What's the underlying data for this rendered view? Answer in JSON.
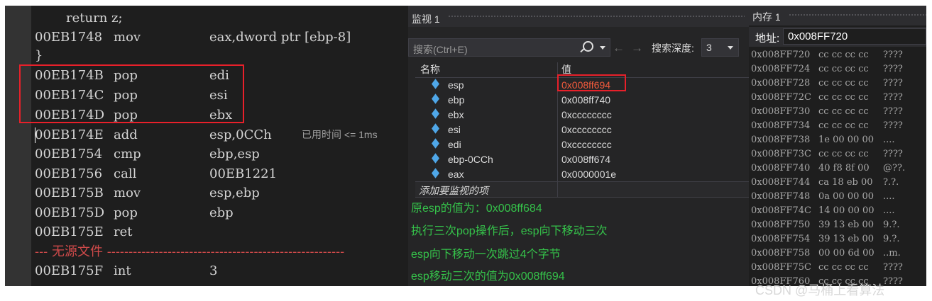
{
  "disasm": {
    "source_return": "return z;",
    "brace": "}",
    "lines": [
      {
        "addr": "00EB1748",
        "op": "mov",
        "arg": "eax,dword ptr [ebp-8]"
      },
      {
        "addr": "00EB174B",
        "op": "pop",
        "arg": "edi"
      },
      {
        "addr": "00EB174C",
        "op": "pop",
        "arg": "esi"
      },
      {
        "addr": "00EB174D",
        "op": "pop",
        "arg": "ebx"
      },
      {
        "addr": "00EB174E",
        "op": "add",
        "arg": "esp,0CCh"
      },
      {
        "addr": "00EB1754",
        "op": "cmp",
        "arg": "ebp,esp"
      },
      {
        "addr": "00EB1756",
        "op": "call",
        "arg": "00EB1221"
      },
      {
        "addr": "00EB175B",
        "op": "mov",
        "arg": "esp,ebp"
      },
      {
        "addr": "00EB175D",
        "op": "pop",
        "arg": "ebp"
      },
      {
        "addr": "00EB175E",
        "op": "ret",
        "arg": ""
      },
      {
        "addr": "00EB175F",
        "op": "int",
        "arg": "3"
      }
    ],
    "no_source_label": "--- 无源文件 -------------------------------------------------------",
    "elapsed": "已用时间 <= 1ms",
    "current_icon": "current-instruction-arrow-icon"
  },
  "watch": {
    "title": "监视 1",
    "search_placeholder": "搜索(Ctrl+E)",
    "search_icon": "search-icon",
    "depth_label": "搜索深度:",
    "depth_value": "3",
    "col_name": "名称",
    "col_value": "值",
    "rows": [
      {
        "name": "esp",
        "value": "0x008ff694",
        "changed": true
      },
      {
        "name": "ebp",
        "value": "0x008ff740",
        "changed": false
      },
      {
        "name": "ebx",
        "value": "0xcccccccc",
        "changed": false
      },
      {
        "name": "esi",
        "value": "0xcccccccc",
        "changed": false
      },
      {
        "name": "edi",
        "value": "0xcccccccc",
        "changed": false
      },
      {
        "name": "ebp-0CCh",
        "value": "0x008ff674",
        "changed": false
      },
      {
        "name": "eax",
        "value": "0x0000001e",
        "changed": false
      }
    ],
    "add_item": "添加要监视的项",
    "notes": [
      "原esp的值为：0x008ff684",
      "执行三次pop操作后，esp向下移动三次",
      "esp向下移动一次跳过4个字节",
      "esp移动三次的值为0x008ff694"
    ]
  },
  "memory": {
    "title": "内存 1",
    "address_label": "地址:",
    "address_value": "0x008FF720",
    "rows": [
      {
        "addr": "0x008FF720",
        "bytes": "cc cc cc cc",
        "text": "????"
      },
      {
        "addr": "0x008FF724",
        "bytes": "cc cc cc cc",
        "text": "????"
      },
      {
        "addr": "0x008FF728",
        "bytes": "cc cc cc cc",
        "text": "????"
      },
      {
        "addr": "0x008FF72C",
        "bytes": "cc cc cc cc",
        "text": "????"
      },
      {
        "addr": "0x008FF730",
        "bytes": "cc cc cc cc",
        "text": "????"
      },
      {
        "addr": "0x008FF734",
        "bytes": "cc cc cc cc",
        "text": "????"
      },
      {
        "addr": "0x008FF738",
        "bytes": "1e 00 00 00",
        "text": "...."
      },
      {
        "addr": "0x008FF73C",
        "bytes": "cc cc cc cc",
        "text": "????"
      },
      {
        "addr": "0x008FF740",
        "bytes": "40 f8 8f 00",
        "text": "@??."
      },
      {
        "addr": "0x008FF744",
        "bytes": "ca 18 eb 00",
        "text": "?.?."
      },
      {
        "addr": "0x008FF748",
        "bytes": "0a 00 00 00",
        "text": "...."
      },
      {
        "addr": "0x008FF74C",
        "bytes": "14 00 00 00",
        "text": "...."
      },
      {
        "addr": "0x008FF750",
        "bytes": "39 13 eb 00",
        "text": "9.?."
      },
      {
        "addr": "0x008FF754",
        "bytes": "39 13 eb 00",
        "text": "9.?."
      },
      {
        "addr": "0x008FF758",
        "bytes": "00 00 6d 00",
        "text": "..m."
      },
      {
        "addr": "0x008FF75C",
        "bytes": "cc cc cc cc",
        "text": "????"
      },
      {
        "addr": "0x008FF760",
        "bytes": "cc cc cc cc",
        "text": "????"
      }
    ]
  },
  "watermark": "CSDN @马桶上看算法",
  "colors": {
    "highlight_box": "#e8202a",
    "changed_value": "#f25a3c",
    "note_text": "#35c24a",
    "no_source": "#d04a4a"
  }
}
